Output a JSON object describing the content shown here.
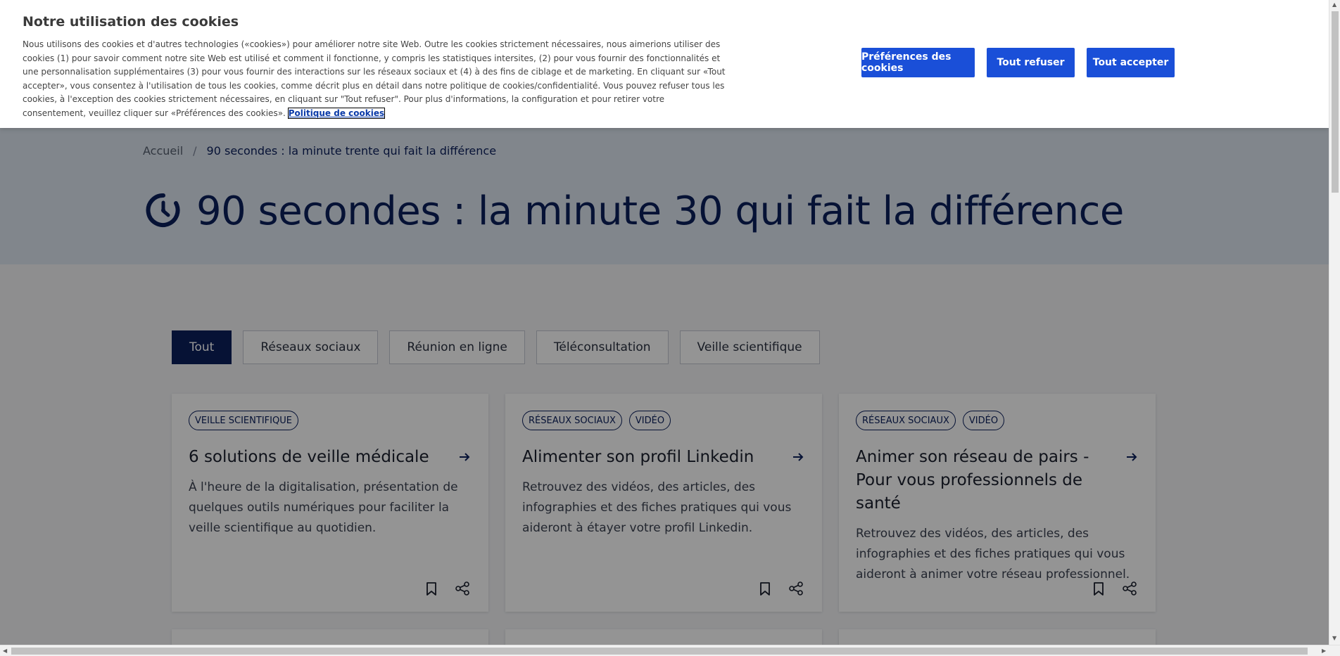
{
  "page": {
    "breadcrumb": {
      "home": "Accueil",
      "separator": "/",
      "current": "90 secondes : la minute trente qui fait la différence"
    },
    "title": "90 secondes : la minute 30 qui fait la différence",
    "title_icon": "timer-icon",
    "filters": [
      {
        "label": "Tout",
        "active": true
      },
      {
        "label": "Réseaux sociaux",
        "active": false
      },
      {
        "label": "Réunion en ligne",
        "active": false
      },
      {
        "label": "Téléconsultation",
        "active": false
      },
      {
        "label": "Veille scientifique",
        "active": false
      }
    ],
    "cards": [
      {
        "tags": [
          "VEILLE SCIENTIFIQUE"
        ],
        "title": "6 solutions de veille médicale",
        "description": "À l'heure de la digitalisation, présentation de quelques outils numériques pour faciliter la veille scientifique au quotidien."
      },
      {
        "tags": [
          "RÉSEAUX SOCIAUX",
          "VIDÉO"
        ],
        "title": "Alimenter son profil Linkedin",
        "description": "Retrouvez des vidéos, des articles, des infographies et des fiches pratiques qui vous aideront à étayer votre profil Linkedin."
      },
      {
        "tags": [
          "RÉSEAUX SOCIAUX",
          "VIDÉO"
        ],
        "title": "Animer son réseau de pairs - Pour vous professionnels de santé",
        "description": "Retrouvez des vidéos, des articles, des infographies et des fiches pratiques qui vous aideront à animer votre réseau professionnel."
      }
    ]
  },
  "cookie_banner": {
    "title": "Notre utilisation des cookies",
    "text": "Nous utilisons des cookies et d'autres technologies («cookies») pour améliorer notre site Web. Outre les cookies strictement nécessaires, nous aimerions utiliser des cookies (1) pour savoir comment notre site Web est utilisé et comment il fonctionne, y compris les statistiques intersites, (2) pour vous fournir des fonctionnalités et une personnalisation supplémentaires (3) pour vous fournir des interactions sur les réseaux sociaux et (4) à des fins de ciblage et de marketing. En cliquant sur «Tout accepter», vous consentez à l'utilisation de tous les cookies, comme décrit plus en détail dans notre politique de cookies/confidentialité. Vous pouvez refuser tous les cookies, à l'exception des cookies strictement nécessaires, en cliquant sur \"Tout refuser\". Pour plus d'informations, la configuration et pour retirer votre consentement, veuillez cliquer sur «Préférences des cookies».",
    "policy_link": "Politique de cookies",
    "buttons": {
      "preferences": "Préférences des cookies",
      "reject": "Tout refuser",
      "accept": "Tout accepter"
    }
  },
  "colors": {
    "brand_navy": "#0b1f5c",
    "button_blue": "#1a4fd8",
    "hero_bg": "#dfe7f2"
  }
}
